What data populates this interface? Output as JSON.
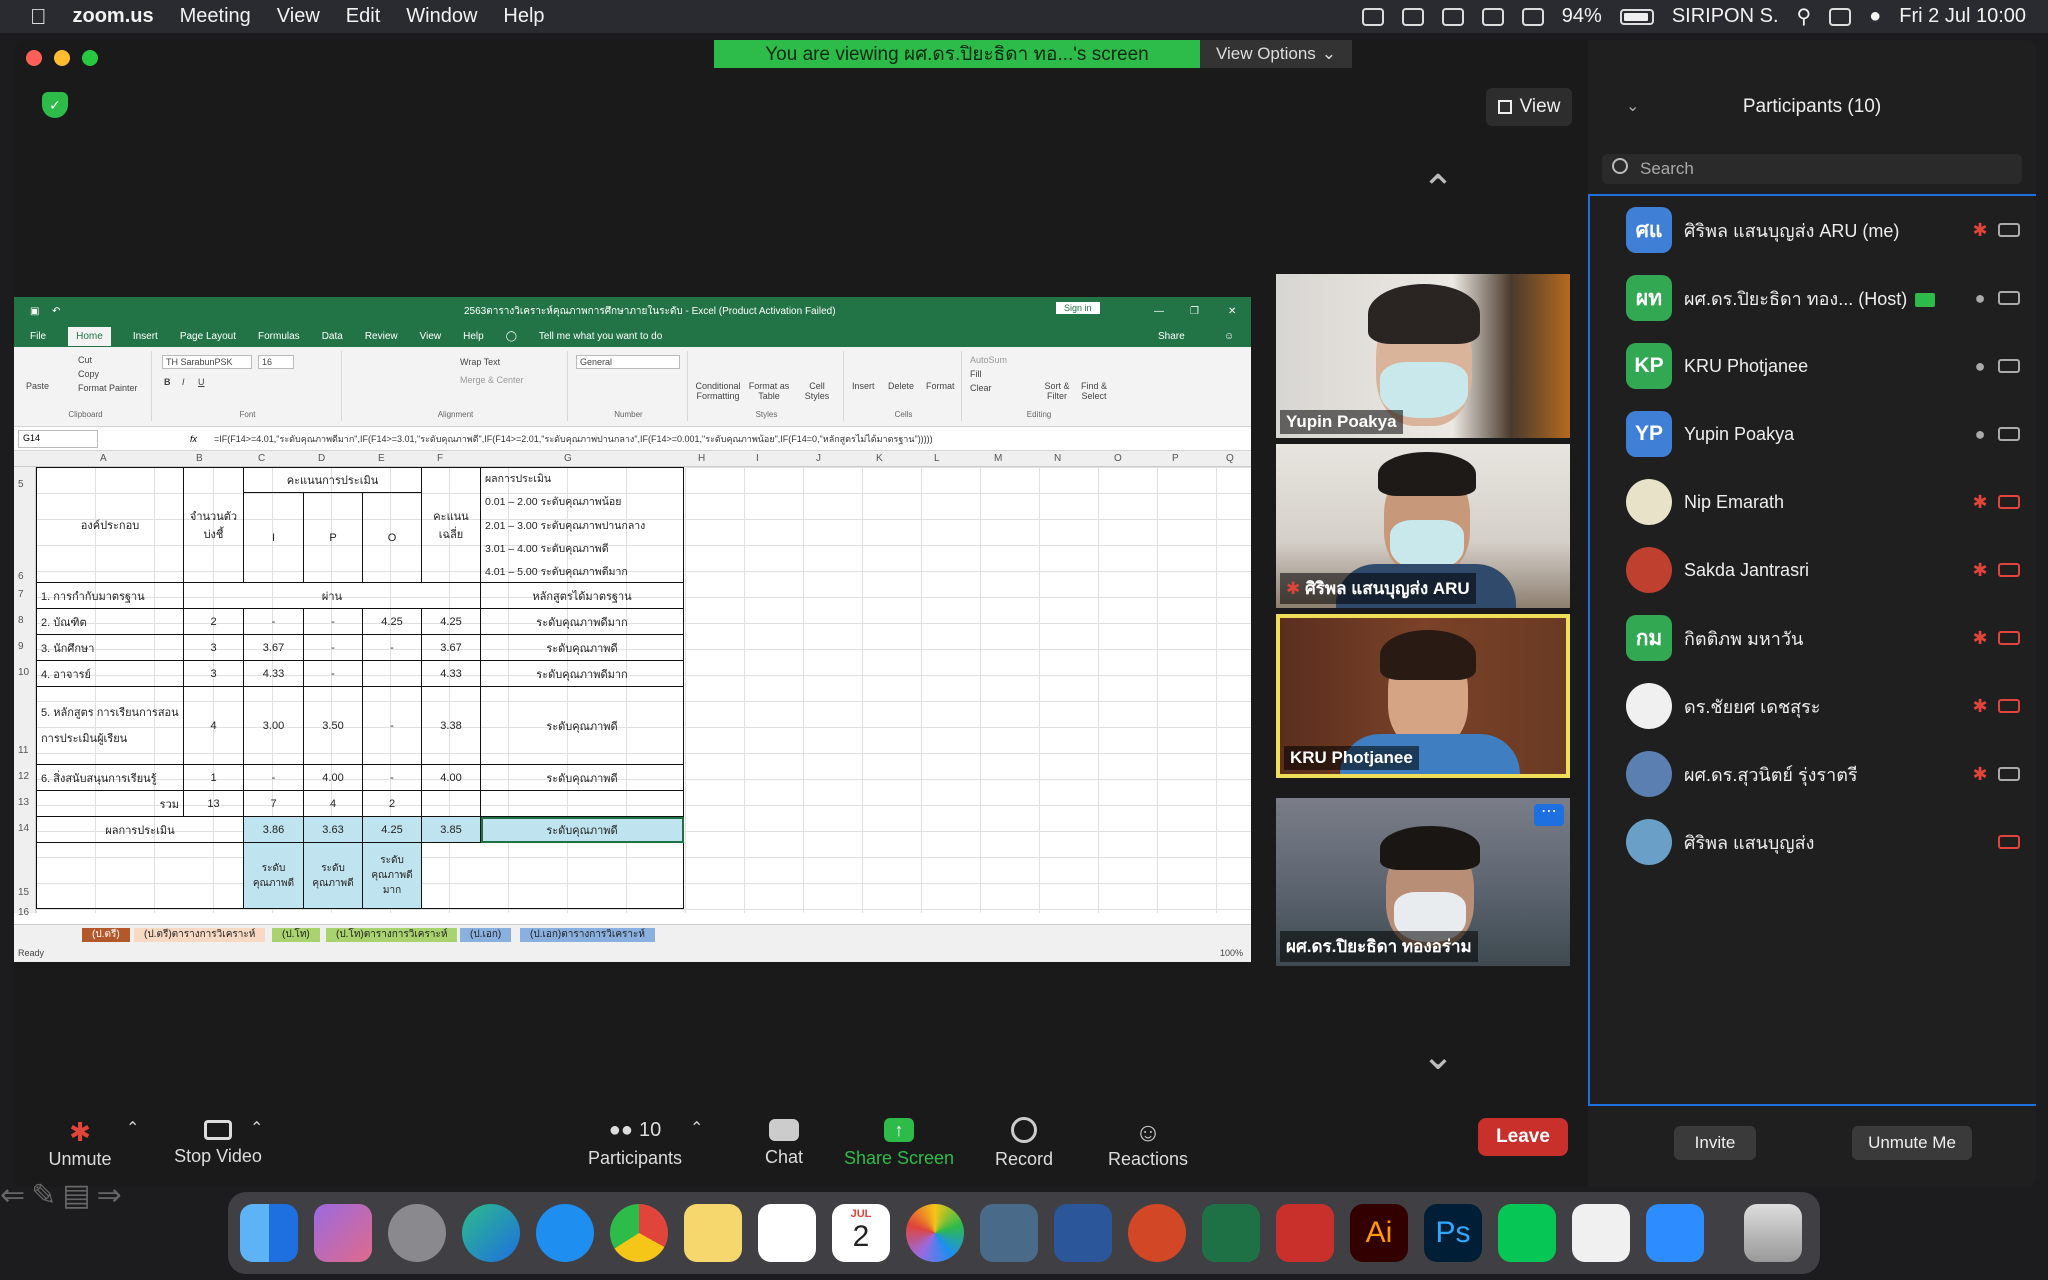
{
  "menubar": {
    "app_name": "zoom.us",
    "menus": [
      "Meeting",
      "View",
      "Edit",
      "Window",
      "Help"
    ],
    "battery": "94%",
    "user": "SIRIPON S.",
    "datetime": "Fri 2 Jul  10:00"
  },
  "banner": {
    "text": "You are viewing ผศ.ดร.ปิยะธิดา ทอ...'s screen",
    "view_options": "View Options"
  },
  "view_button": "View",
  "excel": {
    "title": "2563ตารางวิเคราะห์คุณภาพการศึกษาภายในระดับ - Excel (Product Activation Failed)",
    "sign_in": "Sign in",
    "tabs": [
      "File",
      "Home",
      "Insert",
      "Page Layout",
      "Formulas",
      "Data",
      "Review",
      "View",
      "Help"
    ],
    "tell_me": "Tell me what you want to do",
    "share": "Share",
    "ribbon": {
      "paste": "Paste",
      "cut": "Cut",
      "copy": "Copy",
      "format_painter": "Format Painter",
      "font_name": "TH SarabunPSK",
      "font_size": "16",
      "wrap_text": "Wrap Text",
      "merge_center": "Merge & Center",
      "number_format": "General",
      "conditional_formatting": "Conditional Formatting",
      "format_as_table": "Format as Table",
      "cell_styles": "Cell Styles",
      "insert": "Insert",
      "delete": "Delete",
      "format": "Format",
      "autosum": "AutoSum",
      "fill": "Fill",
      "clear": "Clear",
      "sort_filter": "Sort & Filter",
      "find_select": "Find & Select",
      "groups": [
        "Clipboard",
        "Font",
        "Alignment",
        "Number",
        "Styles",
        "Cells",
        "Editing"
      ]
    },
    "name_box": "G14",
    "formula": "=IF(F14>=4.01,\"ระดับคุณภาพดีมาก\",IF(F14>=3.01,\"ระดับคุณภาพดี\",IF(F14>=2.01,\"ระดับคุณภาพปานกลาง\",IF(F14>=0.001,\"ระดับคุณภาพน้อย\",IF(F14=0,\"หลักสูตรไม่ได้มาตรฐาน\")))))",
    "columns": [
      "A",
      "B",
      "C",
      "D",
      "E",
      "F",
      "G",
      "H",
      "I",
      "J",
      "K",
      "L",
      "M",
      "N",
      "O",
      "P",
      "Q"
    ],
    "rows": [
      "5",
      "6",
      "7",
      "8",
      "9",
      "10",
      "11",
      "12",
      "13",
      "14",
      "15",
      "16"
    ],
    "header": {
      "component": "องค์ประกอบ",
      "num_indicators": "จำนวนตัวบ่งชี้",
      "scores": "คะแนนการประเมิน",
      "i": "I",
      "p": "P",
      "o": "O",
      "avg": "คะแนนเฉลี่ย",
      "result_title": "ผลการประเมิน",
      "levels": [
        "0.01 – 2.00 ระดับคุณภาพน้อย",
        "2.01 – 3.00 ระดับคุณภาพปานกลาง",
        "3.01 – 4.00 ระดับคุณภาพดี",
        "4.01 – 5.00 ระดับคุณภาพดีมาก"
      ]
    },
    "data_rows": [
      {
        "a": "1. การกำกับมาตรฐาน",
        "bcdef": "ผ่าน",
        "g": "หลักสูตรได้มาตรฐาน"
      },
      {
        "a": "2. บัณฑิต",
        "b": "2",
        "c": "-",
        "d": "-",
        "e": "4.25",
        "f": "4.25",
        "g": "ระดับคุณภาพดีมาก"
      },
      {
        "a": "3. นักศึกษา",
        "b": "3",
        "c": "3.67",
        "d": "-",
        "e": "-",
        "f": "3.67",
        "g": "ระดับคุณภาพดี"
      },
      {
        "a": "4. อาจารย์",
        "b": "3",
        "c": "4.33",
        "d": "-",
        "e": "",
        "f": "4.33",
        "g": "ระดับคุณภาพดีมาก"
      },
      {
        "a": "5. หลักสูตร การเรียนการสอน การประเมินผู้เรียน",
        "b": "4",
        "c": "3.00",
        "d": "3.50",
        "e": "-",
        "f": "3.38",
        "g": "ระดับคุณภาพดี"
      },
      {
        "a": "6. สิ่งสนับสนุนการเรียนรู้",
        "b": "1",
        "c": "-",
        "d": "4.00",
        "e": "-",
        "f": "4.00",
        "g": "ระดับคุณภาพดี"
      }
    ],
    "total_row": {
      "a": "รวม",
      "b": "13",
      "c": "7",
      "d": "4",
      "e": "2"
    },
    "result_row": {
      "a": "ผลการประเมิน",
      "c": "3.86",
      "d": "3.63",
      "e": "4.25",
      "f": "3.85",
      "g": "ระดับคุณภาพดี"
    },
    "level_row": {
      "c": "ระดับคุณภาพดี",
      "d": "ระดับคุณภาพดี",
      "e": "ระดับคุณภาพดีมาก"
    },
    "sheet_tabs": [
      "(ป.ตรี)",
      "(ป.ตรี)ตารางการวิเคราะห์",
      "(ป.โท)",
      "(ป.โท)ตารางการวิเคราะห์",
      "(ป.เอก)",
      "(ป.เอก)ตารางการวิเคราะห์"
    ],
    "status": "Ready",
    "zoom": "100%"
  },
  "videos": [
    {
      "name": "Yupin Poakya"
    },
    {
      "name": "ศิริพล แสนบุญส่ง ARU"
    },
    {
      "name": "KRU Photjanee"
    },
    {
      "name": "ผศ.ดร.ปิยะธิดา ทองอร่าม"
    }
  ],
  "participants": {
    "title": "Participants (10)",
    "search_placeholder": "Search",
    "list": [
      {
        "initials": "ศแ",
        "name": "ศิริพล แสนบุญส่ง ARU (me)",
        "color": "#3f7fd6",
        "mic": "muted",
        "cam": "on"
      },
      {
        "initials": "ผท",
        "name": "ผศ.ดร.ปิยะธิดา ทอง... (Host)",
        "color": "#33a853",
        "mic": "on",
        "cam": "on"
      },
      {
        "initials": "KP",
        "name": "KRU Photjanee",
        "color": "#33a853",
        "mic": "on",
        "cam": "on"
      },
      {
        "initials": "YP",
        "name": "Yupin Poakya",
        "color": "#3f7fd6",
        "mic": "on",
        "cam": "on"
      },
      {
        "initials": "",
        "name": "Nip Emarath",
        "color": "#e8e2c8",
        "mic": "muted",
        "cam": "off"
      },
      {
        "initials": "",
        "name": "Sakda Jantrasri",
        "color": "#c04030",
        "mic": "muted",
        "cam": "off"
      },
      {
        "initials": "กม",
        "name": "กิตติภพ มหาวัน",
        "color": "#33a853",
        "mic": "muted",
        "cam": "off"
      },
      {
        "initials": "",
        "name": "ดร.ชัยยศ เดชสุระ",
        "color": "#f0f0f0",
        "mic": "muted",
        "cam": "off"
      },
      {
        "initials": "",
        "name": "ผศ.ดร.สุวนิตย์ รุ่งราตรี",
        "color": "#5a7fb0",
        "mic": "muted",
        "cam": "on"
      },
      {
        "initials": "",
        "name": "ศิริพล แสนบุญส่ง",
        "color": "#6aa0c8",
        "mic": "none",
        "cam": "off"
      }
    ],
    "invite": "Invite",
    "unmute_me": "Unmute Me"
  },
  "toolbar": {
    "unmute": "Unmute",
    "stop_video": "Stop Video",
    "participants": "Participants",
    "participants_count": "10",
    "chat": "Chat",
    "share_screen": "Share Screen",
    "record": "Record",
    "reactions": "Reactions",
    "leave": "Leave"
  },
  "calendar": {
    "month": "JUL",
    "day": "2"
  }
}
